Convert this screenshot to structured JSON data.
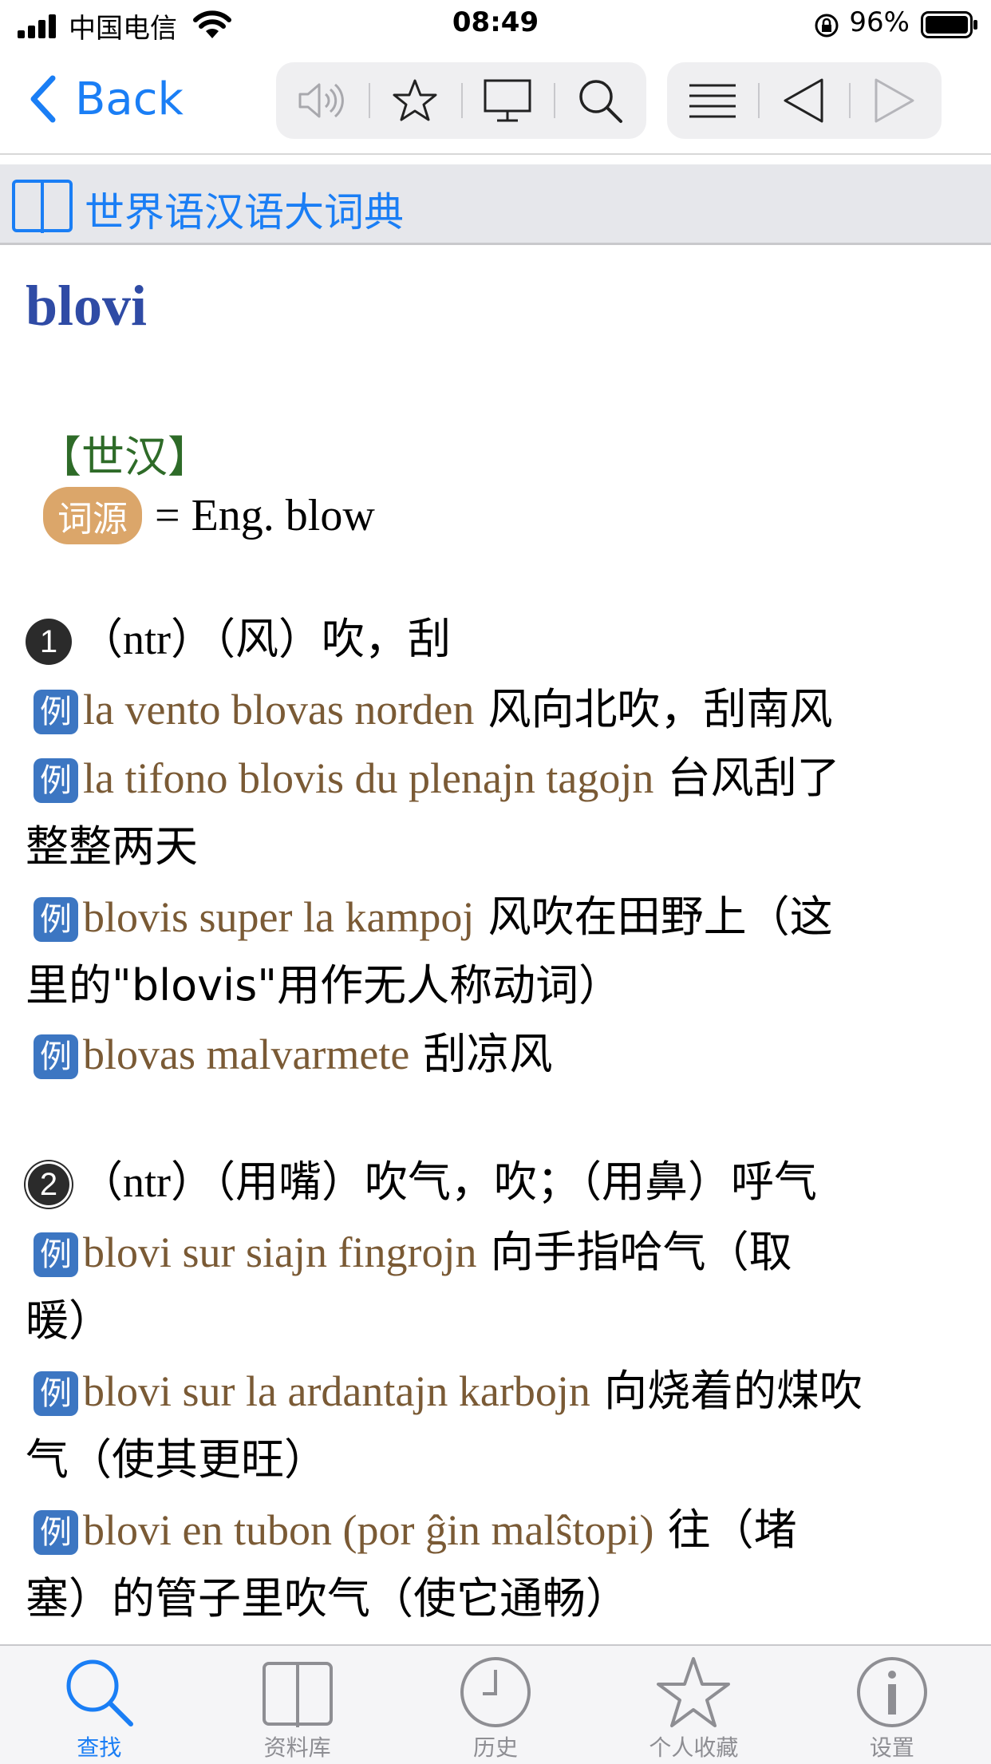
{
  "status_bar": {
    "carrier": "中国电信",
    "time": "08:49",
    "battery_percent": "96%"
  },
  "nav": {
    "back_label": "Back",
    "toolbar_icons": [
      "speaker-icon",
      "star-icon",
      "monitor-icon",
      "search-icon",
      "list-icon",
      "triangle-left-icon",
      "triangle-right-icon"
    ]
  },
  "dictionary": {
    "name": "世界语汉语大词典"
  },
  "entry": {
    "headword": "blovi",
    "source_tag": "【世汉】",
    "etymology_badge": "词源",
    "etymology_text": "= Eng. blow",
    "example_badge": "例",
    "sense1": {
      "number": "1",
      "definition": "（ntr）（风）吹，刮",
      "examples": [
        {
          "eo": "la vento blovas norden",
          "zh": " 风向北吹，刮南风"
        },
        {
          "eo": "la tifono blovis du plenajn tagojn",
          "zh": " 台风刮了",
          "zh_cont": "整整两天"
        },
        {
          "eo": "blovis super la kampoj",
          "zh": " 风吹在田野上（这",
          "zh_cont": "里的\"blovis\"用作无人称动词）"
        },
        {
          "eo": "blovas malvarmete",
          "zh": " 刮凉风"
        }
      ]
    },
    "sense2": {
      "number": "2",
      "definition": "（ntr）（用嘴）吹气，吹；（用鼻）呼气",
      "examples": [
        {
          "eo": "blovi sur siajn fingrojn",
          "zh": " 向手指哈气（取",
          "zh_cont": "暖）"
        },
        {
          "eo": "blovi sur la ardantajn karbojn",
          "zh": " 向烧着的煤吹",
          "zh_cont": "气（使其更旺）"
        },
        {
          "eo": "blovi en tubon (por ĝin malŝtopi)",
          "zh": " 往（堵",
          "zh_cont": "塞）的管子里吹气（使它通畅）"
        }
      ]
    }
  },
  "tabbar": {
    "tabs": [
      {
        "label": "查找",
        "icon": "search-icon",
        "active": true
      },
      {
        "label": "资料库",
        "icon": "book-icon",
        "active": false
      },
      {
        "label": "历史",
        "icon": "clock-icon",
        "active": false
      },
      {
        "label": "个人收藏",
        "icon": "star-icon",
        "active": false
      },
      {
        "label": "设置",
        "icon": "info-icon",
        "active": false
      }
    ]
  },
  "colors": {
    "accent": "#1a7ef5",
    "headword": "#2f4ba5",
    "source_tag": "#2e6b28",
    "etymology_badge": "#dba66a",
    "example_badge": "#3c76c2",
    "esperanto_text": "#7a5a35"
  }
}
